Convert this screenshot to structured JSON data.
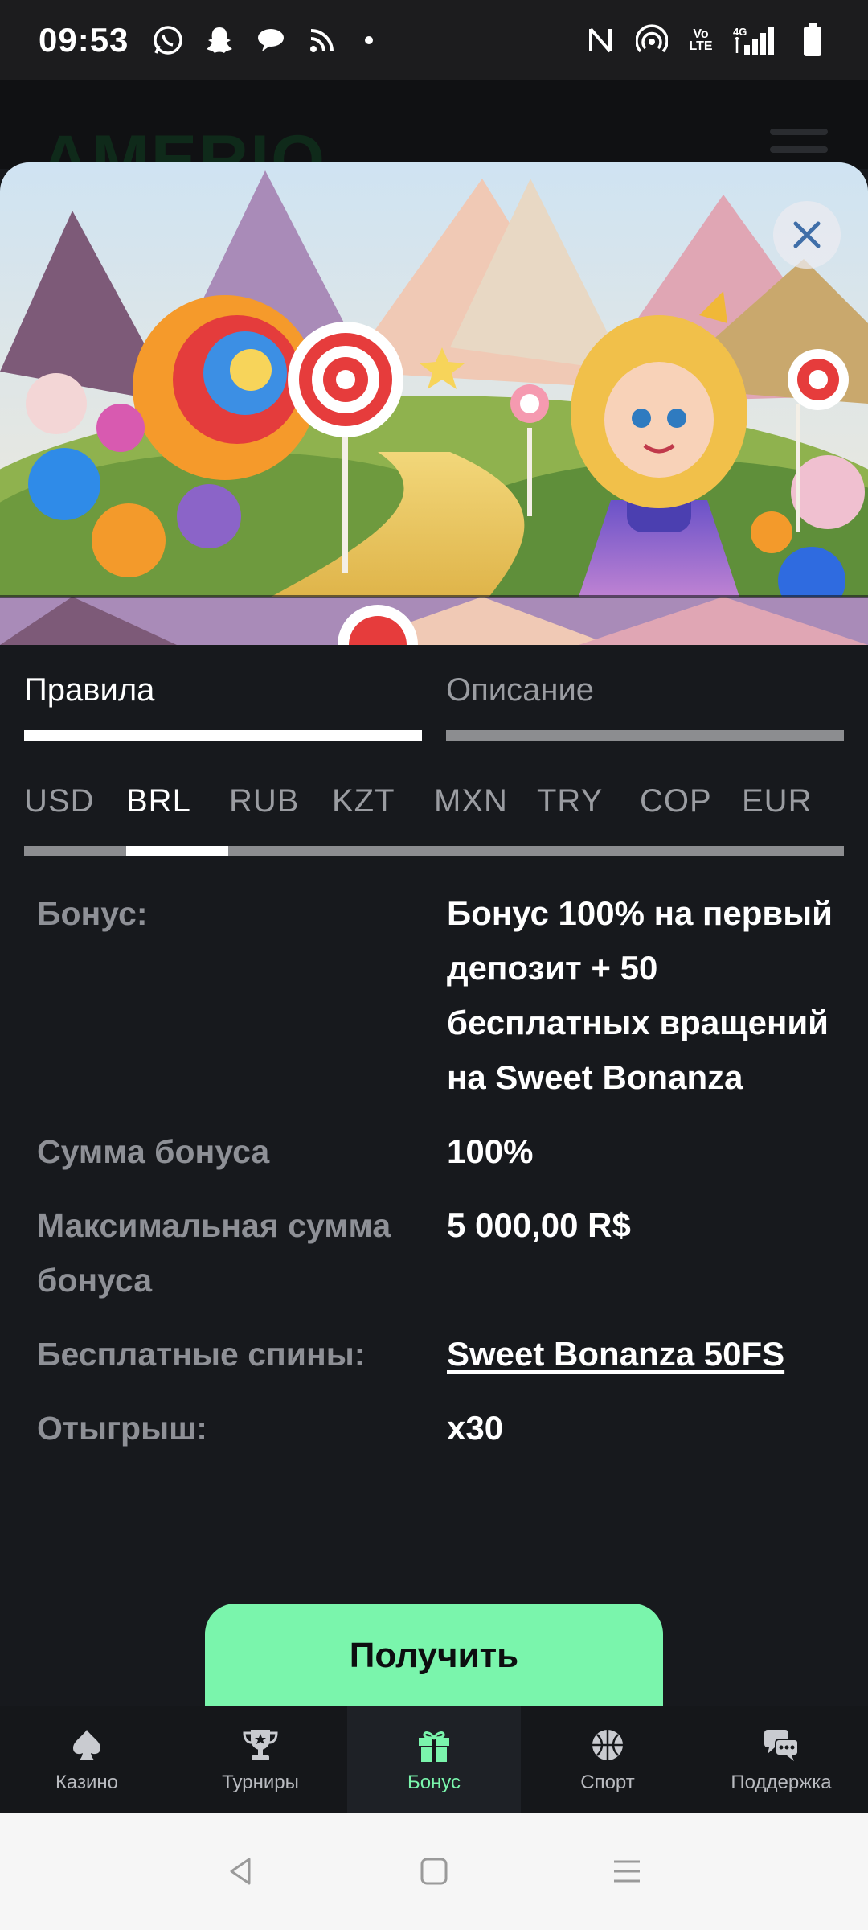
{
  "status_bar": {
    "time": "09:53",
    "left_icons": [
      "whatsapp-icon",
      "snapchat-icon",
      "chat-icon",
      "rss-icon"
    ],
    "right_icons": [
      "nfc-icon",
      "hotspot-icon",
      "volte-icon",
      "signal-icon",
      "battery-icon"
    ],
    "volte_label": "Vo LTE",
    "network_label": "4G"
  },
  "background_page": {
    "logo_text": "AMERIO"
  },
  "modal": {
    "tabs": [
      {
        "label": "Правила",
        "active": true
      },
      {
        "label": "Описание",
        "active": false
      }
    ],
    "currencies": [
      {
        "code": "USD",
        "active": false
      },
      {
        "code": "BRL",
        "active": true
      },
      {
        "code": "RUB",
        "active": false
      },
      {
        "code": "KZT",
        "active": false
      },
      {
        "code": "MXN",
        "active": false
      },
      {
        "code": "TRY",
        "active": false
      },
      {
        "code": "COP",
        "active": false
      },
      {
        "code": "EUR",
        "active": false
      }
    ],
    "details": [
      {
        "key": "Бонус:",
        "value": "Бонус 100% на первый депозит + 50 бесплатных вращений на Sweet Bonanza"
      },
      {
        "key": "Сумма бонуса",
        "value": "100%"
      },
      {
        "key": "Максимальная сумма бонуса",
        "value": "5 000,00 R$"
      },
      {
        "key": "Бесплатные спины:",
        "value": "Sweet Bonanza 50FS",
        "link": true
      },
      {
        "key": "Отыгрыш:",
        "value": "x30"
      }
    ],
    "cta_label": "Получить"
  },
  "bottom_nav": [
    {
      "label": "Казино",
      "icon": "spade-icon",
      "active": false
    },
    {
      "label": "Турниры",
      "icon": "trophy-icon",
      "active": false
    },
    {
      "label": "Бонус",
      "icon": "gift-icon",
      "active": true
    },
    {
      "label": "Спорт",
      "icon": "ball-icon",
      "active": false
    },
    {
      "label": "Поддержка",
      "icon": "chat-bubbles-icon",
      "active": false
    }
  ],
  "colors": {
    "accent": "#7af5ac",
    "background": "#17191d",
    "muted_text": "#8e9096"
  }
}
